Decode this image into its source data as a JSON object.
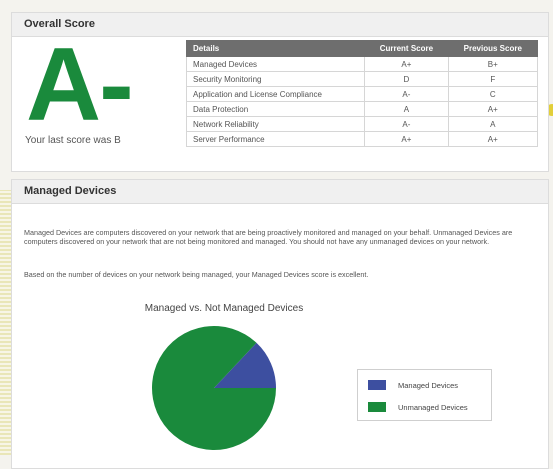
{
  "overall": {
    "header": "Overall Score",
    "grade": "A-",
    "last_score": "Your last score was B",
    "table": {
      "headers": [
        "Details",
        "Current Score",
        "Previous Score"
      ],
      "rows": [
        {
          "detail": "Managed Devices",
          "current": "A+",
          "previous": "B+"
        },
        {
          "detail": "Security Monitoring",
          "current": "D",
          "previous": "F"
        },
        {
          "detail": "Application and License Compliance",
          "current": "A-",
          "previous": "C"
        },
        {
          "detail": "Data Protection",
          "current": "A",
          "previous": "A+"
        },
        {
          "detail": "Network Reliability",
          "current": "A-",
          "previous": "A"
        },
        {
          "detail": "Server Performance",
          "current": "A+",
          "previous": "A+"
        }
      ]
    },
    "grade_color": "#1a8a3c"
  },
  "devices": {
    "header": "Managed Devices",
    "paragraph_1": "Managed Devices are computers discovered on your network that are being proactively monitored and managed on your behalf. Unmanaged Devices are computers discovered on your network that are not being monitored and managed. You should not have any unmanaged devices on your network.",
    "paragraph_2": "Based on the number of devices on your network being managed, your Managed Devices score is excellent.",
    "chart_title": "Managed vs. Not Managed Devices",
    "legend": [
      {
        "label": "Managed Devices",
        "color": "#3d4fa0"
      },
      {
        "label": "Unmanaged Devices",
        "color": "#1a8a3c"
      }
    ]
  },
  "chart_data": {
    "type": "pie",
    "title": "Managed vs. Not Managed Devices",
    "slices": [
      {
        "name": "Managed Devices",
        "value": 13,
        "color": "#3d4fa0"
      },
      {
        "name": "Unmanaged Devices",
        "value": 87,
        "color": "#1a8a3c"
      }
    ],
    "legend_position": "right"
  }
}
